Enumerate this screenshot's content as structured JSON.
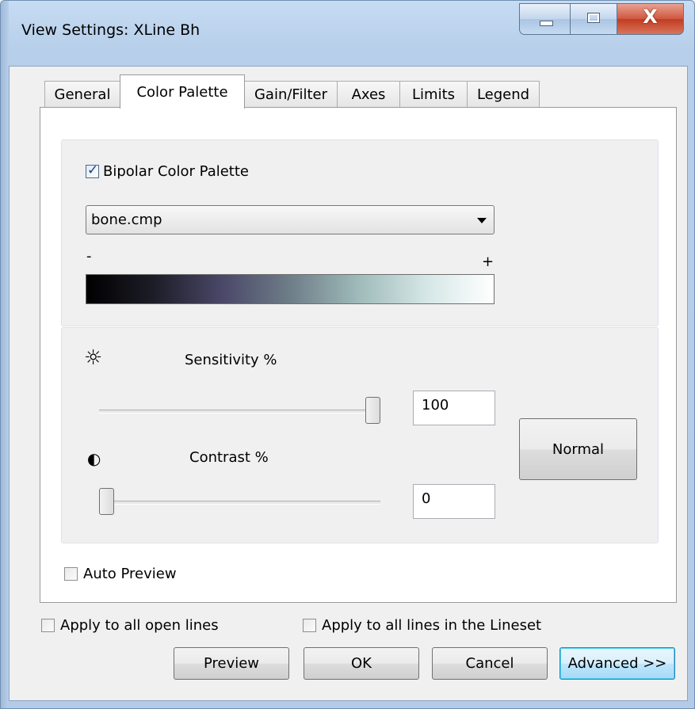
{
  "window": {
    "title": "View Settings: XLine Bh"
  },
  "tabs": [
    {
      "label": "General"
    },
    {
      "label": "Color Palette",
      "active": true
    },
    {
      "label": "Gain/Filter"
    },
    {
      "label": "Axes"
    },
    {
      "label": "Limits"
    },
    {
      "label": "Legend"
    }
  ],
  "palette": {
    "bipolar_label": "Bipolar Color Palette",
    "bipolar_checked": true,
    "selected_file": "bone.cmp",
    "minus_label": "-",
    "plus_label": "+",
    "gradient_colors": [
      "#000000",
      "#1d1d28",
      "#4a4868",
      "#6e7d88",
      "#9ebab9",
      "#d5e6e6",
      "#ffffff"
    ]
  },
  "sensitivity": {
    "icon": "brightness-icon",
    "label": "Sensitivity %",
    "value": "100",
    "slider_fraction": 1.0
  },
  "contrast": {
    "icon": "contrast-icon",
    "label": "Contrast %",
    "value": "0",
    "slider_fraction": 0.0
  },
  "normal_button": "Normal",
  "auto_preview": {
    "label": "Auto Preview",
    "checked": false
  },
  "apply_all_open": {
    "label": "Apply to all open lines",
    "checked": false
  },
  "apply_lineset": {
    "label": "Apply to all lines in the Lineset",
    "checked": false
  },
  "buttons": {
    "preview": "Preview",
    "ok": "OK",
    "cancel": "Cancel",
    "advanced": "Advanced >>"
  },
  "caption": {
    "close_glyph": "X"
  }
}
